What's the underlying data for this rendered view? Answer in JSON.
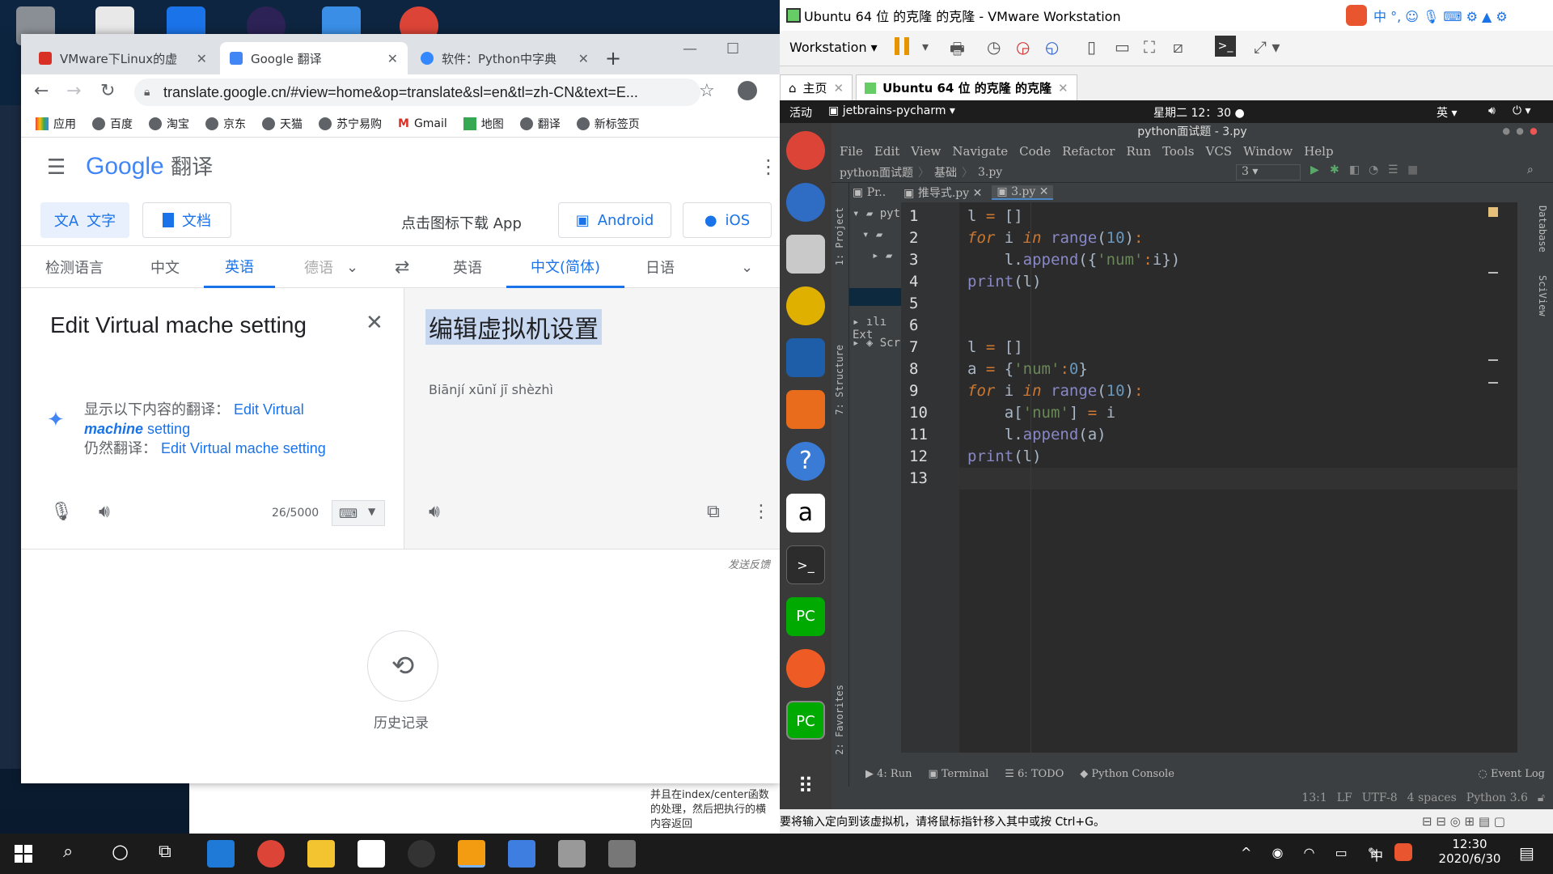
{
  "chrome": {
    "tabs": [
      {
        "label": "VMware下Linux的虚",
        "icon_color": "#d93025"
      },
      {
        "label": "Google 翻译",
        "icon_color": "#4285f4"
      },
      {
        "label": "软件：Python中字典",
        "icon_color": "#3388ff"
      }
    ],
    "url": "translate.google.cn/#view=home&op=translate&sl=en&tl=zh-CN&text=E...",
    "bookmarks": [
      "应用",
      "百度",
      "淘宝",
      "京东",
      "天猫",
      "苏宁易购",
      "Gmail",
      "地图",
      "翻译",
      "新标签页"
    ]
  },
  "translate": {
    "logo_google": "Google",
    "logo_suffix": "翻译",
    "mode_text": "文字",
    "mode_doc": "文档",
    "download_label": "点击图标下载 App",
    "android_label": "Android",
    "ios_label": "iOS",
    "source_langs": [
      "检测语言",
      "中文",
      "英语",
      "德语"
    ],
    "target_langs": [
      "英语",
      "中文(简体)",
      "日语"
    ],
    "source_text": "Edit Virtual mache setting",
    "translated_text": "编辑虚拟机设置",
    "pinyin": "Biānjí xūnǐ jī shèzhì",
    "suggest_prefix": "显示以下内容的翻译：",
    "suggest_part1": "Edit Virtual",
    "suggest_part2": "machine",
    "suggest_part3": "setting",
    "still_prefix": "仍然翻译：",
    "still_text": "Edit Virtual mache setting",
    "char_count": "26/5000",
    "feedback": "发送反馈",
    "history_label": "历史记录"
  },
  "behind_text": [
    "并且在index/center函数",
    "的处理，然后把执行的横",
    "内容返回"
  ],
  "vmware": {
    "title": "Ubuntu 64 位 的克隆 的克隆 - VMware Workstation",
    "workstation_menu": "Workstation",
    "tabs": [
      "主页",
      "Ubuntu 64 位 的克隆 的克隆"
    ],
    "status_msg": "要将输入定向到该虚拟机，请将鼠标指针移入其中或按 Ctrl+G。"
  },
  "ubuntu": {
    "activities": "活动",
    "app_menu": "jetbrains-pycharm",
    "clock": "星期二 12：30",
    "ime": "英",
    "dock_tooltip": "帮助"
  },
  "pycharm": {
    "title": "python面试题 - 3.py",
    "menu": [
      "File",
      "Edit",
      "View",
      "Navigate",
      "Code",
      "Refactor",
      "Run",
      "Tools",
      "VCS",
      "Window",
      "Help"
    ],
    "breadcrumb": [
      "python面试题",
      "基础",
      "3.py"
    ],
    "run_config": "3",
    "tabs": [
      "Pr..",
      "推导式.py",
      "3.py"
    ],
    "side_labels": [
      "1: Project",
      "7: Structure",
      "2: Favorites",
      "Database",
      "SciView"
    ],
    "project_items": [
      "pyt",
      "Ext",
      "Scr"
    ],
    "code_lines": [
      "l = []",
      "for i in range(10):",
      "    l.append({'num':i})",
      "print(l)",
      "",
      "",
      "l = []",
      "a = {'num':0}",
      "for i in range(10):",
      "    a['num'] = i",
      "    l.append(a)",
      "print(l)",
      ""
    ],
    "line_numbers": [
      "1",
      "2",
      "3",
      "4",
      "5",
      "6",
      "7",
      "8",
      "9",
      "10",
      "11",
      "12",
      "13"
    ],
    "bottom_tabs": [
      "4: Run",
      "Terminal",
      "6: TODO",
      "Python Console"
    ],
    "event_log": "Event Log",
    "status": {
      "pos": "13:1",
      "eol": "LF",
      "enc": "UTF-8",
      "indent": "4 spaces",
      "interp": "Python 3.6"
    }
  },
  "taskbar": {
    "time": "12:30",
    "date": "2020/6/30",
    "ime": "中"
  }
}
